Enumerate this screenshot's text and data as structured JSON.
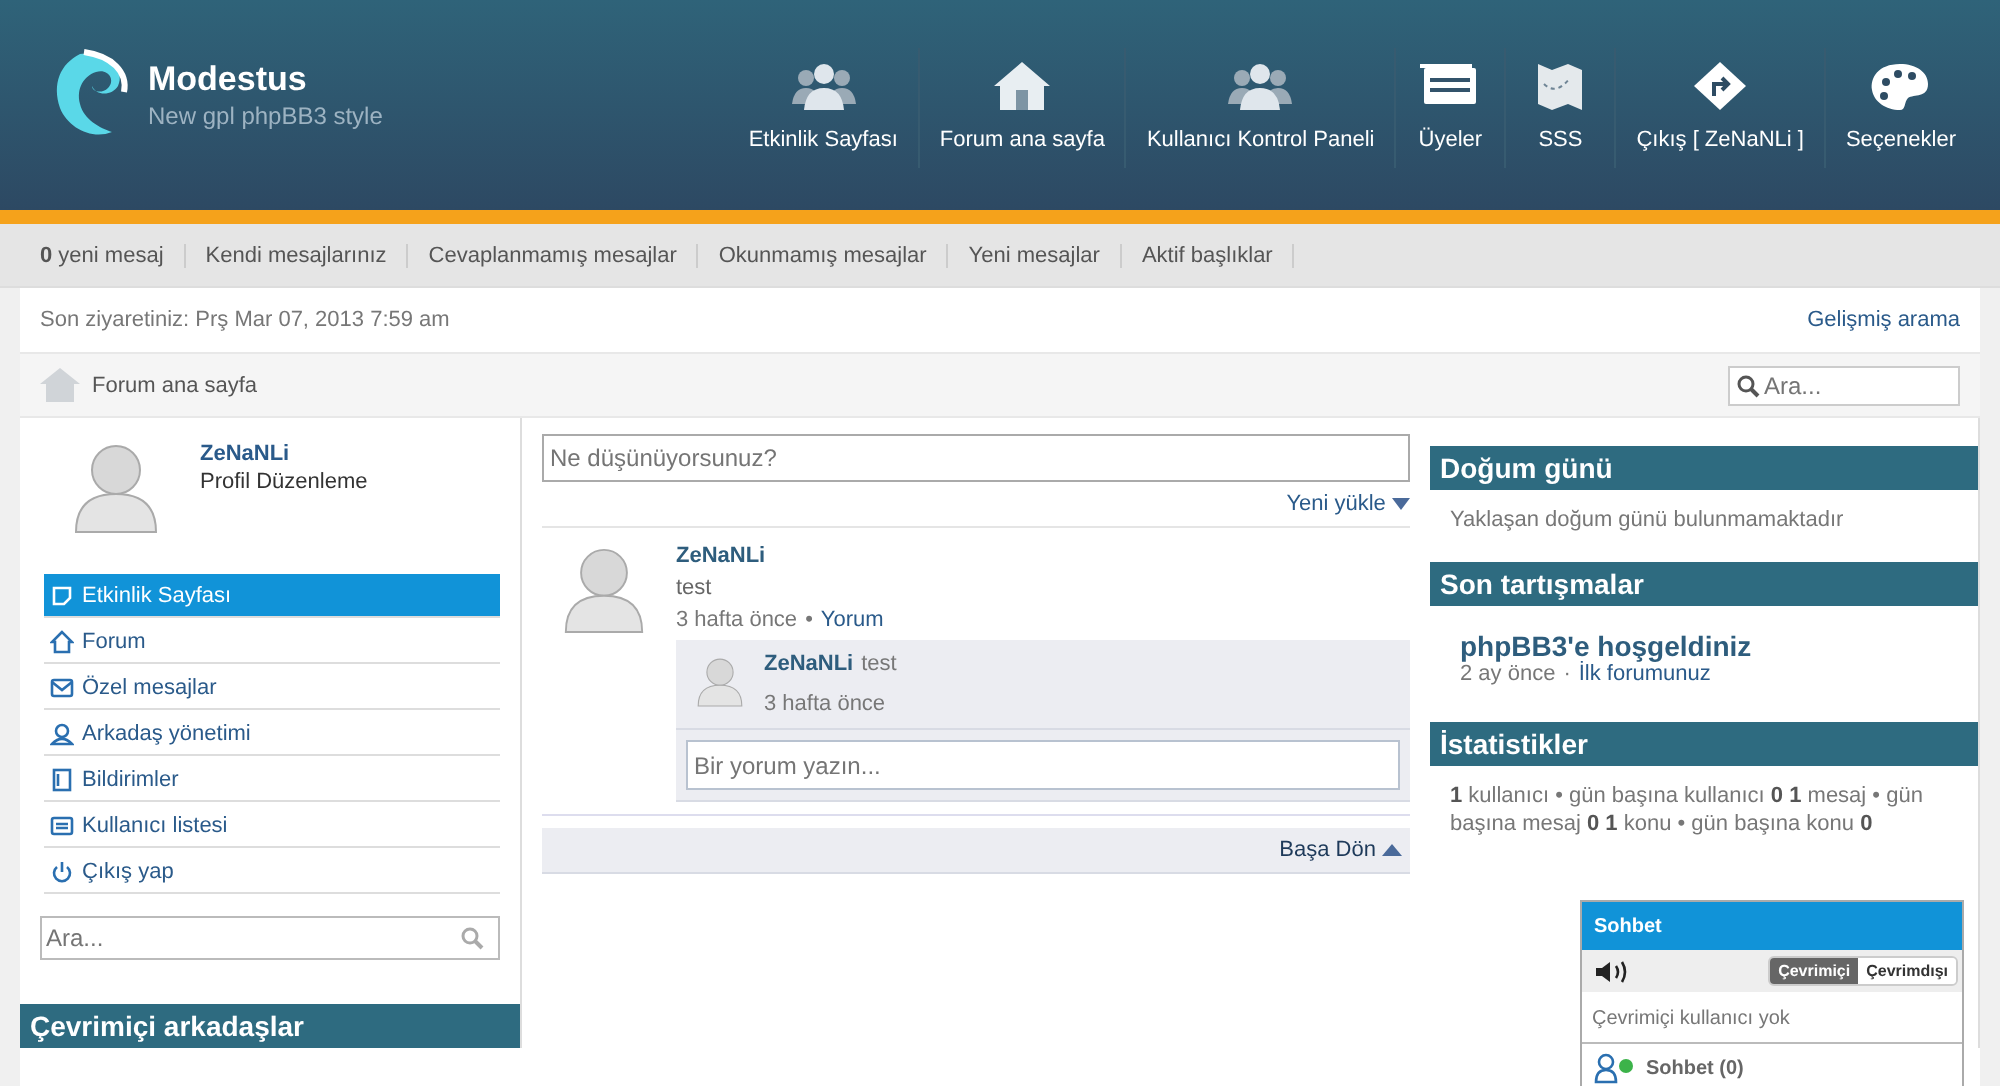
{
  "logo": {
    "title": "Modestus",
    "subtitle": "New gpl phpBB3 style"
  },
  "header_nav": [
    {
      "label": "Etkinlik Sayfası",
      "kind": "users"
    },
    {
      "label": "Forum ana sayfa",
      "kind": "home"
    },
    {
      "label": "Kullanıcı Kontrol Paneli",
      "kind": "users"
    },
    {
      "label": "Üyeler",
      "kind": "cards"
    },
    {
      "label": "SSS",
      "kind": "map"
    },
    {
      "label": "Çıkış [ ZeNaNLi ]",
      "kind": "exit"
    },
    {
      "label": "Seçenekler",
      "kind": "palette"
    }
  ],
  "quick_links": [
    "**0** yeni mesaj",
    "Kendi mesajlarınız",
    "Cevaplanmamış mesajlar",
    "Okunmamış mesajlar",
    "Yeni mesajlar",
    "Aktif başlıklar"
  ],
  "last_visit": "Son ziyaretiniz: Prş Mar 07, 2013 7:59 am",
  "advanced_search": "Gelişmiş arama",
  "breadcrumb": "Forum ana sayfa",
  "top_search": {
    "placeholder": "Ara..."
  },
  "profile": {
    "name": "ZeNaNLi",
    "edit_link": "Profil Düzenleme"
  },
  "sidebar": {
    "items": [
      {
        "label": "Etkinlik Sayfası",
        "kind": "note",
        "selected": true
      },
      {
        "label": "Forum",
        "kind": "home",
        "selected": false
      },
      {
        "label": "Özel mesajlar",
        "kind": "mail",
        "selected": false
      },
      {
        "label": "Arkadaş yönetimi",
        "kind": "friend",
        "selected": false
      },
      {
        "label": "Bildirimler",
        "kind": "doc",
        "selected": false
      },
      {
        "label": "Kullanıcı listesi",
        "kind": "list",
        "selected": false
      },
      {
        "label": "Çıkış yap",
        "kind": "power",
        "selected": false
      }
    ],
    "search": {
      "placeholder": "Ara..."
    },
    "online_friends_title": "Çevrimiçi arkadaşlar"
  },
  "status_box": {
    "placeholder": "Ne düşünüyorsunuz?"
  },
  "load_new": "Yeni yükle",
  "posts": [
    {
      "author": "ZeNaNLi",
      "text": "test",
      "time": "3 hafta önce",
      "separator": "•",
      "comment_link": "Yorum",
      "comments": [
        {
          "author": "ZeNaNLi",
          "text": "test",
          "time": "3 hafta önce"
        }
      ],
      "comment_box": {
        "placeholder": "Bir yorum yazın..."
      }
    }
  ],
  "back_to_top": "Başa Dön",
  "birthday": {
    "title": "Doğum günü",
    "text": "Yaklaşan doğum günü bulunmamaktadır"
  },
  "recent": {
    "title": "Son tartışmalar",
    "topics": [
      {
        "title": "phpBB3'e hoşgeldiniz",
        "time": "2 ay önce",
        "separator": "·",
        "forum": "İlk forumunuz"
      }
    ]
  },
  "stats": {
    "title": "İstatistikler",
    "text": "**1** kullanıcı • gün başına kullanıcı **0** **1** mesaj • gün başına mesaj **0** **1** konu • gün başına konu **0**"
  },
  "chat": {
    "title": "Sohbet",
    "tabs": [
      {
        "label": "Çevrimiçi",
        "selected": true
      },
      {
        "label": "Çevrimdışı",
        "selected": false
      }
    ],
    "empty": "Çevrimiçi kullanıcı yok",
    "footer": "Sohbet (0)"
  }
}
